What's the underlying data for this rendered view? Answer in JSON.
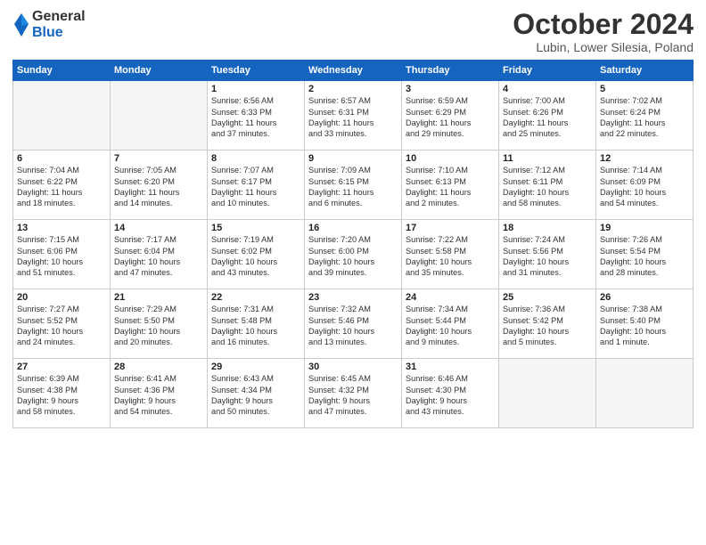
{
  "header": {
    "logo_general": "General",
    "logo_blue": "Blue",
    "month_title": "October 2024",
    "location": "Lubin, Lower Silesia, Poland"
  },
  "weekdays": [
    "Sunday",
    "Monday",
    "Tuesday",
    "Wednesday",
    "Thursday",
    "Friday",
    "Saturday"
  ],
  "weeks": [
    [
      {
        "day": "",
        "empty": true
      },
      {
        "day": "",
        "empty": true
      },
      {
        "day": "1",
        "lines": [
          "Sunrise: 6:56 AM",
          "Sunset: 6:33 PM",
          "Daylight: 11 hours",
          "and 37 minutes."
        ]
      },
      {
        "day": "2",
        "lines": [
          "Sunrise: 6:57 AM",
          "Sunset: 6:31 PM",
          "Daylight: 11 hours",
          "and 33 minutes."
        ]
      },
      {
        "day": "3",
        "lines": [
          "Sunrise: 6:59 AM",
          "Sunset: 6:29 PM",
          "Daylight: 11 hours",
          "and 29 minutes."
        ]
      },
      {
        "day": "4",
        "lines": [
          "Sunrise: 7:00 AM",
          "Sunset: 6:26 PM",
          "Daylight: 11 hours",
          "and 25 minutes."
        ]
      },
      {
        "day": "5",
        "lines": [
          "Sunrise: 7:02 AM",
          "Sunset: 6:24 PM",
          "Daylight: 11 hours",
          "and 22 minutes."
        ]
      }
    ],
    [
      {
        "day": "6",
        "lines": [
          "Sunrise: 7:04 AM",
          "Sunset: 6:22 PM",
          "Daylight: 11 hours",
          "and 18 minutes."
        ]
      },
      {
        "day": "7",
        "lines": [
          "Sunrise: 7:05 AM",
          "Sunset: 6:20 PM",
          "Daylight: 11 hours",
          "and 14 minutes."
        ]
      },
      {
        "day": "8",
        "lines": [
          "Sunrise: 7:07 AM",
          "Sunset: 6:17 PM",
          "Daylight: 11 hours",
          "and 10 minutes."
        ]
      },
      {
        "day": "9",
        "lines": [
          "Sunrise: 7:09 AM",
          "Sunset: 6:15 PM",
          "Daylight: 11 hours",
          "and 6 minutes."
        ]
      },
      {
        "day": "10",
        "lines": [
          "Sunrise: 7:10 AM",
          "Sunset: 6:13 PM",
          "Daylight: 11 hours",
          "and 2 minutes."
        ]
      },
      {
        "day": "11",
        "lines": [
          "Sunrise: 7:12 AM",
          "Sunset: 6:11 PM",
          "Daylight: 10 hours",
          "and 58 minutes."
        ]
      },
      {
        "day": "12",
        "lines": [
          "Sunrise: 7:14 AM",
          "Sunset: 6:09 PM",
          "Daylight: 10 hours",
          "and 54 minutes."
        ]
      }
    ],
    [
      {
        "day": "13",
        "lines": [
          "Sunrise: 7:15 AM",
          "Sunset: 6:06 PM",
          "Daylight: 10 hours",
          "and 51 minutes."
        ]
      },
      {
        "day": "14",
        "lines": [
          "Sunrise: 7:17 AM",
          "Sunset: 6:04 PM",
          "Daylight: 10 hours",
          "and 47 minutes."
        ]
      },
      {
        "day": "15",
        "lines": [
          "Sunrise: 7:19 AM",
          "Sunset: 6:02 PM",
          "Daylight: 10 hours",
          "and 43 minutes."
        ]
      },
      {
        "day": "16",
        "lines": [
          "Sunrise: 7:20 AM",
          "Sunset: 6:00 PM",
          "Daylight: 10 hours",
          "and 39 minutes."
        ]
      },
      {
        "day": "17",
        "lines": [
          "Sunrise: 7:22 AM",
          "Sunset: 5:58 PM",
          "Daylight: 10 hours",
          "and 35 minutes."
        ]
      },
      {
        "day": "18",
        "lines": [
          "Sunrise: 7:24 AM",
          "Sunset: 5:56 PM",
          "Daylight: 10 hours",
          "and 31 minutes."
        ]
      },
      {
        "day": "19",
        "lines": [
          "Sunrise: 7:26 AM",
          "Sunset: 5:54 PM",
          "Daylight: 10 hours",
          "and 28 minutes."
        ]
      }
    ],
    [
      {
        "day": "20",
        "lines": [
          "Sunrise: 7:27 AM",
          "Sunset: 5:52 PM",
          "Daylight: 10 hours",
          "and 24 minutes."
        ]
      },
      {
        "day": "21",
        "lines": [
          "Sunrise: 7:29 AM",
          "Sunset: 5:50 PM",
          "Daylight: 10 hours",
          "and 20 minutes."
        ]
      },
      {
        "day": "22",
        "lines": [
          "Sunrise: 7:31 AM",
          "Sunset: 5:48 PM",
          "Daylight: 10 hours",
          "and 16 minutes."
        ]
      },
      {
        "day": "23",
        "lines": [
          "Sunrise: 7:32 AM",
          "Sunset: 5:46 PM",
          "Daylight: 10 hours",
          "and 13 minutes."
        ]
      },
      {
        "day": "24",
        "lines": [
          "Sunrise: 7:34 AM",
          "Sunset: 5:44 PM",
          "Daylight: 10 hours",
          "and 9 minutes."
        ]
      },
      {
        "day": "25",
        "lines": [
          "Sunrise: 7:36 AM",
          "Sunset: 5:42 PM",
          "Daylight: 10 hours",
          "and 5 minutes."
        ]
      },
      {
        "day": "26",
        "lines": [
          "Sunrise: 7:38 AM",
          "Sunset: 5:40 PM",
          "Daylight: 10 hours",
          "and 1 minute."
        ]
      }
    ],
    [
      {
        "day": "27",
        "lines": [
          "Sunrise: 6:39 AM",
          "Sunset: 4:38 PM",
          "Daylight: 9 hours",
          "and 58 minutes."
        ]
      },
      {
        "day": "28",
        "lines": [
          "Sunrise: 6:41 AM",
          "Sunset: 4:36 PM",
          "Daylight: 9 hours",
          "and 54 minutes."
        ]
      },
      {
        "day": "29",
        "lines": [
          "Sunrise: 6:43 AM",
          "Sunset: 4:34 PM",
          "Daylight: 9 hours",
          "and 50 minutes."
        ]
      },
      {
        "day": "30",
        "lines": [
          "Sunrise: 6:45 AM",
          "Sunset: 4:32 PM",
          "Daylight: 9 hours",
          "and 47 minutes."
        ]
      },
      {
        "day": "31",
        "lines": [
          "Sunrise: 6:46 AM",
          "Sunset: 4:30 PM",
          "Daylight: 9 hours",
          "and 43 minutes."
        ]
      },
      {
        "day": "",
        "empty": true
      },
      {
        "day": "",
        "empty": true
      }
    ]
  ]
}
